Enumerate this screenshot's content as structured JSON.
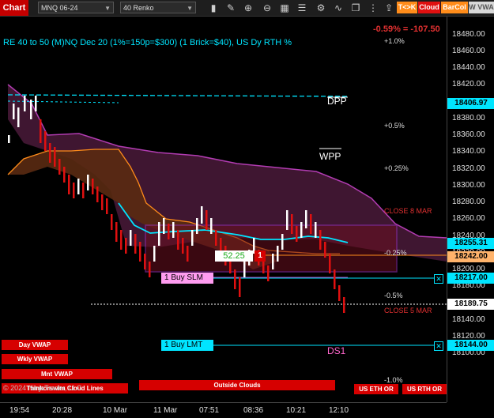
{
  "toolbar": {
    "chart_label": "Chart",
    "instrument": "MNQ 06-24",
    "bar_type": "40 Renko",
    "icons": [
      "bar-style-icon",
      "drawing-tools-icon",
      "scroll-icon",
      "zoom-in-icon",
      "zoom-out-icon",
      "data-box-icon",
      "properties-icon",
      "strategies-icon",
      "indicators-icon",
      "templates-icon",
      "more-icon"
    ],
    "btn_tk": "T<>K",
    "btn_cloud": "Cloud",
    "btn_barcol": "BarCol",
    "btn_vwa": "W VWA"
  },
  "header": {
    "title": "RE 40 to 50 (M)NQ Dec 20 (1%=150p=$300) (1 Brick=$40), US Dy RTH %",
    "change": "-0.59% = -107.50"
  },
  "price_axis": {
    "ticks": [
      "18480.00",
      "18460.00",
      "18440.00",
      "18420.00",
      "18400.00",
      "18380.00",
      "18360.00",
      "18340.00",
      "18320.00",
      "18300.00",
      "18280.00",
      "18260.00",
      "18240.00",
      "18220.00",
      "18200.00",
      "18180.00",
      "18160.00",
      "18140.00",
      "18120.00",
      "18100.00"
    ],
    "tags": [
      {
        "label": "18406.97",
        "color": "#00e5ff"
      },
      {
        "label": "18255.31",
        "color": "#00e5ff"
      },
      {
        "label": "18242.00",
        "color": "#ffb36b"
      },
      {
        "label": "18217.00",
        "color": "#00e5ff"
      },
      {
        "label": "18189.75",
        "color": "#ffffff"
      },
      {
        "label": "18144.00",
        "color": "#00e5ff"
      }
    ]
  },
  "time_axis": [
    "19:54",
    "20:28",
    "10 Mar",
    "11 Mar",
    "07:51",
    "08:36",
    "10:21",
    "12:10"
  ],
  "levels": {
    "dpp": "DPP",
    "wpp": "WPP",
    "ds1": "DS1",
    "pct_up_1": "+1.0%",
    "pct_up_05": "+0.5%",
    "pct_up_025": "+0.25%",
    "pct_dn_025": "-0.25%",
    "pct_dn_05": "-0.5%",
    "pct_dn_1": "-1.0%",
    "close_8mar": "CLOSE 8 MAR",
    "close_5mar": "CLOSE 5 MAR"
  },
  "orders": {
    "buy_slm": "1 Buy SLM",
    "buy_lmt": "1 Buy LMT",
    "position_price": "52.25",
    "position_qty": "1"
  },
  "buttons": {
    "day_vwap": "Day VWAP",
    "wkly_vwap": "Wkly VWAP",
    "mnt_vwap": "Mnt VWAP",
    "thinkorswim_clouds": "Thinkorswim Cloud Lines",
    "outside_clouds": "Outside Clouds",
    "us_eth_or": "US ETH OR",
    "us_rth_or": "US RTH OR"
  },
  "copyright": "© 2024 NinjaTrader, LLC",
  "colors": {
    "brick_up": "#ffffff",
    "brick_down": "#e01010",
    "cloud_magenta": "#b23cb2",
    "cloud_orange": "#ff8c1a",
    "vwap_cyan": "#00e5ff",
    "box_purple": "#9b30c0"
  }
}
